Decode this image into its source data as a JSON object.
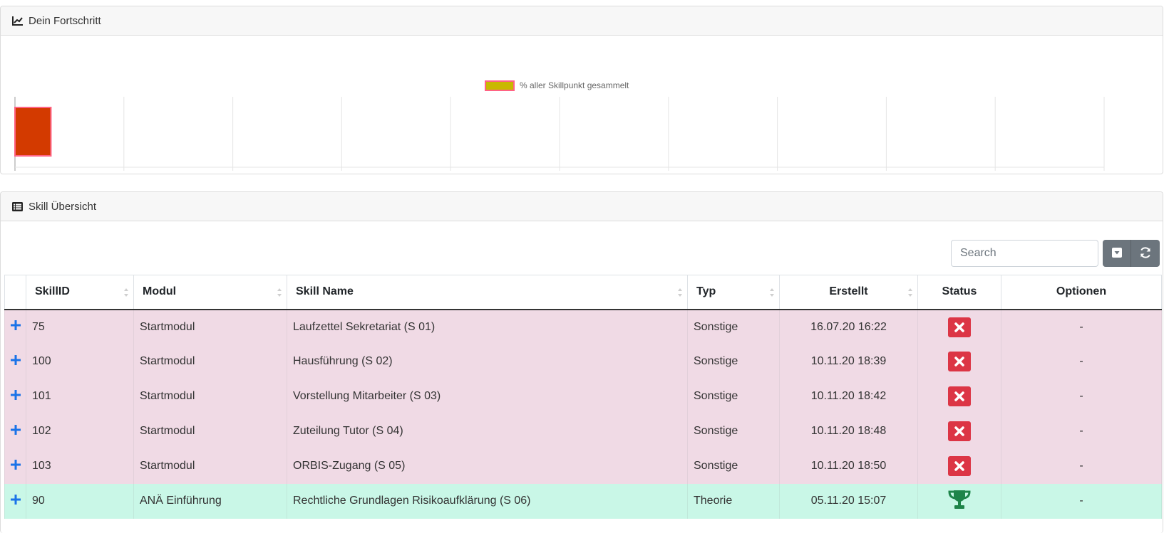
{
  "progress_panel": {
    "title": "Dein Fortschritt",
    "icon": "line-chart-icon"
  },
  "chart_data": {
    "type": "bar",
    "orientation": "horizontal",
    "legend": "% aller Skillpunkt gesammelt",
    "legend_placement": "top-center",
    "categories": [
      ""
    ],
    "series": [
      {
        "name": "% aller Skillpunkt gesammelt",
        "values": [
          3.3
        ]
      }
    ],
    "xlim": [
      0,
      100
    ],
    "xticks": [
      "0",
      "10",
      "20",
      "30",
      "40",
      "50",
      "60",
      "70",
      "80",
      "90",
      "100"
    ],
    "grid": true,
    "colors": {
      "bar_fill": "#d33a00",
      "bar_border": "#ff6384",
      "legend_fill": "#c9b800",
      "legend_border": "#ff6384"
    }
  },
  "skills_panel": {
    "title": "Skill Übersicht",
    "icon": "list-icon",
    "search": {
      "placeholder": "Search",
      "value": ""
    },
    "buttons": {
      "toggle_icon": "caret-down-square-icon",
      "refresh_icon": "refresh-icon"
    },
    "columns": [
      "SkillID",
      "Modul",
      "Skill Name",
      "Typ",
      "Erstellt",
      "Status",
      "Optionen"
    ],
    "rows": [
      {
        "id": "75",
        "modul": "Startmodul",
        "name": "Laufzettel Sekretariat (S 01)",
        "typ": "Sonstige",
        "erstellt": "16.07.20 16:22",
        "status": "not-completed",
        "optionen": "-"
      },
      {
        "id": "100",
        "modul": "Startmodul",
        "name": "Hausführung (S 02)",
        "typ": "Sonstige",
        "erstellt": "10.11.20 18:39",
        "status": "not-completed",
        "optionen": "-"
      },
      {
        "id": "101",
        "modul": "Startmodul",
        "name": "Vorstellung Mitarbeiter (S 03)",
        "typ": "Sonstige",
        "erstellt": "10.11.20 18:42",
        "status": "not-completed",
        "optionen": "-"
      },
      {
        "id": "102",
        "modul": "Startmodul",
        "name": "Zuteilung Tutor (S 04)",
        "typ": "Sonstige",
        "erstellt": "10.11.20 18:48",
        "status": "not-completed",
        "optionen": "-"
      },
      {
        "id": "103",
        "modul": "Startmodul",
        "name": "ORBIS-Zugang (S 05)",
        "typ": "Sonstige",
        "erstellt": "10.11.20 18:50",
        "status": "not-completed",
        "optionen": "-"
      },
      {
        "id": "90",
        "modul": "ANÄ Einführung",
        "name": "Rechtliche Grundlagen Risikoaufklärung (S 06)",
        "typ": "Theorie",
        "erstellt": "05.11.20 15:07",
        "status": "completed",
        "optionen": "-"
      }
    ],
    "colors": {
      "row_incomplete": "#f0dae5",
      "row_complete": "#c9f7e7",
      "status_x": "#dc3545",
      "trophy": "#1e8449",
      "expand": "#1a73e8"
    }
  }
}
